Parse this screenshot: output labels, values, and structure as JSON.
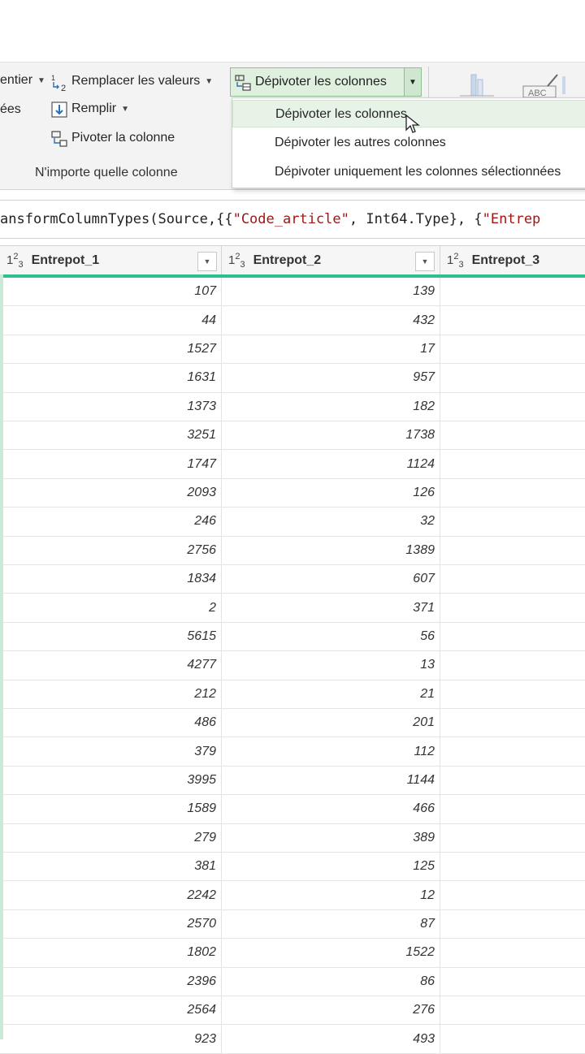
{
  "ribbon": {
    "identify_label": "entier",
    "replace_values_label": "Remplacer les valeurs",
    "unpivot_button_label": "Dépivoter les colonnes",
    "left_partial_label": "ées",
    "fill_label": "Remplir",
    "pivot_label": "Pivoter la colonne",
    "group_label": "N'importe quelle colonne"
  },
  "menu": {
    "items": [
      {
        "label": "Dépivoter les colonnes"
      },
      {
        "label": "Dépivoter les autres colonnes"
      },
      {
        "label": "Dépivoter uniquement les colonnes sélectionnées"
      }
    ]
  },
  "formula": {
    "prefix": "ansformColumnTypes(Source,{{",
    "str1": "\"Code_article\"",
    "mid": ", Int64.Type}, {",
    "str2": "\"Entrep"
  },
  "columns": [
    {
      "type_icon": "1²3",
      "name": "Entrepot_1"
    },
    {
      "type_icon": "1²3",
      "name": "Entrepot_2"
    },
    {
      "type_icon": "1²3",
      "name": "Entrepot_3"
    }
  ],
  "rows": [
    [
      "107",
      "139"
    ],
    [
      "44",
      "432"
    ],
    [
      "1527",
      "17"
    ],
    [
      "1631",
      "957"
    ],
    [
      "1373",
      "182"
    ],
    [
      "3251",
      "1738"
    ],
    [
      "1747",
      "1124"
    ],
    [
      "2093",
      "126"
    ],
    [
      "246",
      "32"
    ],
    [
      "2756",
      "1389"
    ],
    [
      "1834",
      "607"
    ],
    [
      "2",
      "371"
    ],
    [
      "5615",
      "56"
    ],
    [
      "4277",
      "13"
    ],
    [
      "212",
      "21"
    ],
    [
      "486",
      "201"
    ],
    [
      "379",
      "112"
    ],
    [
      "3995",
      "1144"
    ],
    [
      "1589",
      "466"
    ],
    [
      "279",
      "389"
    ],
    [
      "381",
      "125"
    ],
    [
      "2242",
      "12"
    ],
    [
      "2570",
      "87"
    ],
    [
      "1802",
      "1522"
    ],
    [
      "2396",
      "86"
    ],
    [
      "2564",
      "276"
    ],
    [
      "923",
      "493"
    ]
  ]
}
